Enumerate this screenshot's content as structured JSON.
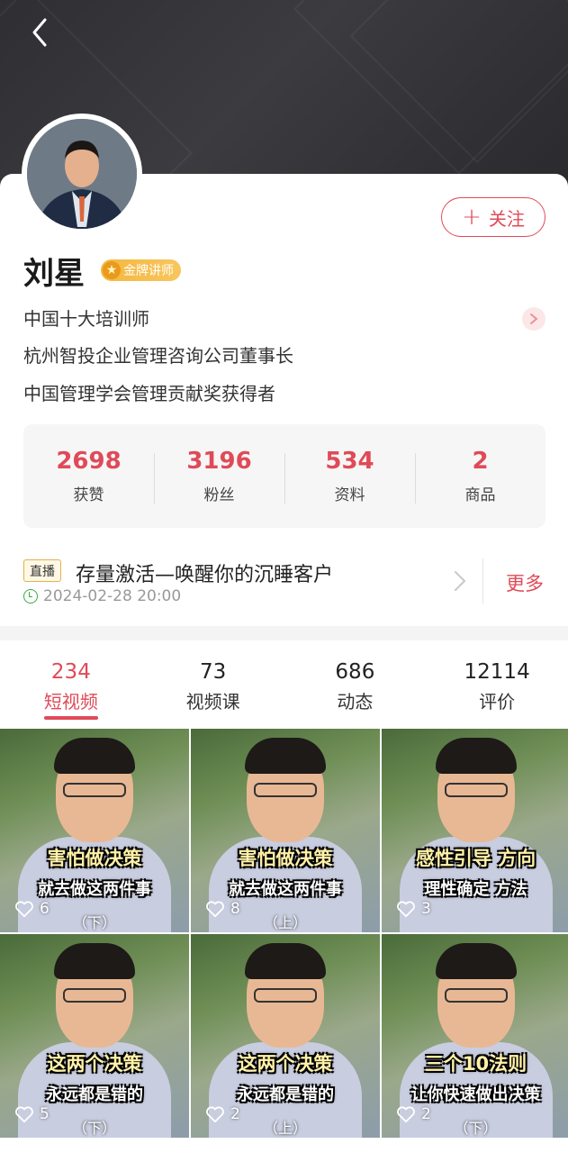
{
  "profile": {
    "name": "刘星",
    "badge": "金牌讲师",
    "follow_label": "关注",
    "bio": [
      "中国十大培训师",
      "杭州智投企业管理咨询公司董事长",
      "中国管理学会管理贡献奖获得者"
    ]
  },
  "stats": [
    {
      "value": "2698",
      "label": "获赞"
    },
    {
      "value": "3196",
      "label": "粉丝"
    },
    {
      "value": "534",
      "label": "资料"
    },
    {
      "value": "2",
      "label": "商品"
    }
  ],
  "live": {
    "tag": "直播",
    "title": "存量激活—唤醒你的沉睡客户",
    "time": "2024-02-28 20:00",
    "more_label": "更多"
  },
  "tabs": [
    {
      "count": "234",
      "label": "短视频",
      "active": true
    },
    {
      "count": "73",
      "label": "视频课"
    },
    {
      "count": "686",
      "label": "动态"
    },
    {
      "count": "12114",
      "label": "评价"
    }
  ],
  "videos": [
    {
      "caption1": "害怕做决策",
      "caption2": "就去做这两件事",
      "part": "（下）",
      "likes": "6"
    },
    {
      "caption1": "害怕做决策",
      "caption2": "就去做这两件事",
      "part": "（上）",
      "likes": "8"
    },
    {
      "caption1": "感性引导 方向",
      "caption2": "理性确定 方法",
      "part": "",
      "likes": "3"
    },
    {
      "caption1": "这两个决策",
      "caption2": "永远都是错的",
      "part": "（下）",
      "likes": "5"
    },
    {
      "caption1": "这两个决策",
      "caption2": "永远都是错的",
      "part": "（上）",
      "likes": "2"
    },
    {
      "caption1": "三个10法则",
      "caption2": "让你快速做出决策",
      "part": "（下）",
      "likes": "2"
    }
  ],
  "colors": {
    "accent": "#e04a58",
    "gold": "#f5b740",
    "header_bg": "#333336"
  }
}
